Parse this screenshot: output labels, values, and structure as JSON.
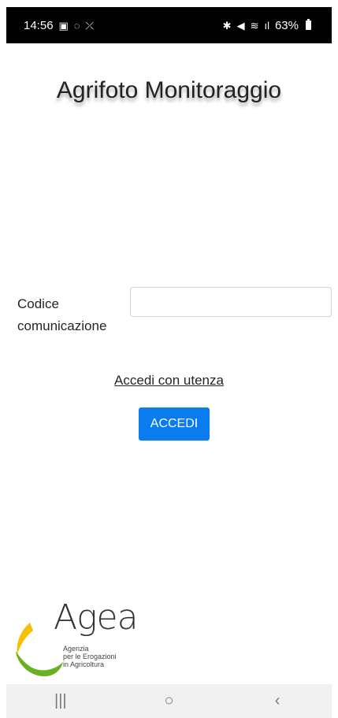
{
  "status_bar": {
    "time": "14:56",
    "battery": "63%",
    "left_icons": [
      "image-icon",
      "whatsapp-icon",
      "missed-call-icon"
    ],
    "right_icons": [
      "bluetooth-icon",
      "mute-icon",
      "wifi-icon",
      "signal-icon"
    ]
  },
  "app": {
    "title": "Agrifoto Monitoraggio"
  },
  "form": {
    "code_label_line1": "Codice",
    "code_label_line2": "comunicazione",
    "code_value": "",
    "user_link": "Accedi con utenza",
    "submit_label": "ACCEDI"
  },
  "logo": {
    "word": "Agea",
    "line1": "Agenzia",
    "line2": "per le Erogazioni",
    "line3": "in Agricoltura",
    "colors": {
      "yellow": "#f2c200",
      "green": "#6ab023"
    }
  },
  "nav": {
    "recents": "|||",
    "home": "○",
    "back": "‹"
  },
  "colors": {
    "primary": "#0a7cf0"
  }
}
